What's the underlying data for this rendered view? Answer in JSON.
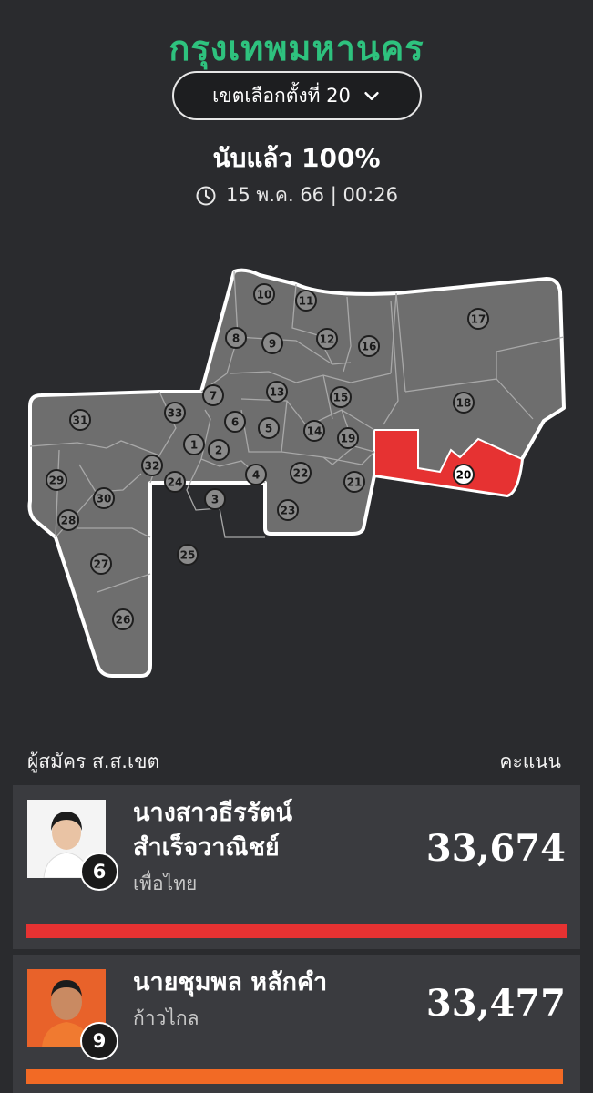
{
  "header": {
    "title": "กรุงเทพมหานคร",
    "district_select": "เขตเลือกตั้งที่ 20",
    "counted": "นับแล้ว 100%",
    "timestamp": "15 พ.ค. 66 | 00:26"
  },
  "map": {
    "districts": [
      "1",
      "2",
      "3",
      "4",
      "5",
      "6",
      "7",
      "8",
      "9",
      "10",
      "11",
      "12",
      "13",
      "14",
      "15",
      "16",
      "17",
      "18",
      "19",
      "20",
      "21",
      "22",
      "23",
      "24",
      "25",
      "26",
      "27",
      "28",
      "29",
      "30",
      "31",
      "32",
      "33"
    ],
    "selected": "20",
    "selected_color": "#e63232",
    "district_color": "#6e6e6e"
  },
  "list": {
    "header_left": "ผู้สมัคร ส.ส.เขต",
    "header_right": "คะแนน"
  },
  "candidates": [
    {
      "name_line1": "นางสาวธีรรัตน์",
      "name_line2": "สำเร็จวาณิชย์",
      "party": "เพื่อไทย",
      "number": "6",
      "votes": "33,674",
      "vote_share_of_max": 1.0,
      "bar_color": "#e63232"
    },
    {
      "name_line1": "นายชุมพล หลักคำ",
      "party": "ก้าวไกล",
      "number": "9",
      "votes": "33,477",
      "vote_share_of_max": 0.994,
      "bar_color": "#f26a25"
    }
  ],
  "icons": {
    "clock": "clock-icon",
    "chevron": "chevron-down-icon"
  }
}
